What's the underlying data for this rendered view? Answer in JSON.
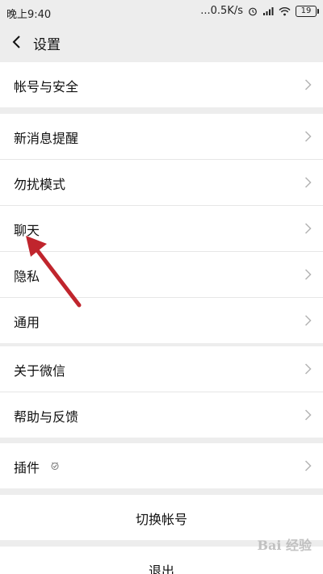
{
  "status_bar": {
    "time": "晚上9:40",
    "network_speed": "...0.5K/s",
    "battery": "19"
  },
  "header": {
    "title": "设置"
  },
  "groups": {
    "account": [
      "帐号与安全"
    ],
    "notifications": [
      "新消息提醒",
      "勿扰模式",
      "聊天",
      "隐私",
      "通用"
    ],
    "about": [
      "关于微信",
      "帮助与反馈"
    ],
    "plugins": [
      "插件"
    ],
    "switch_account": "切换帐号",
    "logout": "退出"
  },
  "watermark": "Bai 经验",
  "colors": {
    "background": "#ededed",
    "card": "#ffffff",
    "arrow": "#c0252d"
  }
}
